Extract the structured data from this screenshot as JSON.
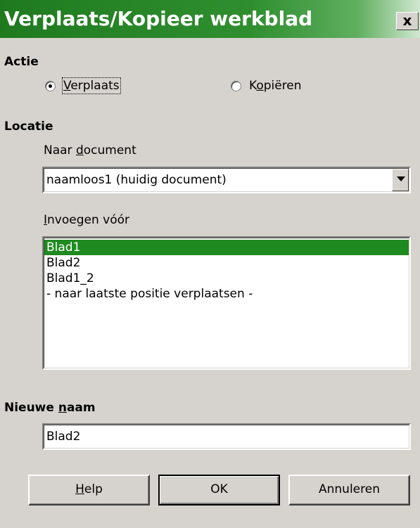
{
  "window": {
    "title": "Verplaats/Kopieer werkblad",
    "close_label": "x"
  },
  "actie": {
    "heading": "Actie",
    "options": [
      {
        "label_prefix": "",
        "label_underline": "V",
        "label_rest": "erplaats",
        "selected": true
      },
      {
        "label_prefix": "K",
        "label_underline": "o",
        "label_rest": "piëren",
        "selected": false
      }
    ]
  },
  "locatie": {
    "heading": "Locatie",
    "document_label_prefix": "Naar ",
    "document_label_underline": "d",
    "document_label_rest": "ocument",
    "document_value": "naamloos1 (huidig document)",
    "insert_label_underline": "I",
    "insert_label_rest": "nvoegen vóór",
    "sheets": [
      {
        "label": "Blad1",
        "selected": true
      },
      {
        "label": "Blad2",
        "selected": false
      },
      {
        "label": "Blad1_2",
        "selected": false
      },
      {
        "label": "- naar laatste positie verplaatsen -",
        "selected": false
      }
    ]
  },
  "new_name": {
    "label_prefix": "Nieuwe ",
    "label_underline": "n",
    "label_rest": "aam",
    "value": "Blad2"
  },
  "buttons": {
    "help_underline": "H",
    "help_rest": "elp",
    "ok": "OK",
    "cancel": "Annuleren"
  }
}
